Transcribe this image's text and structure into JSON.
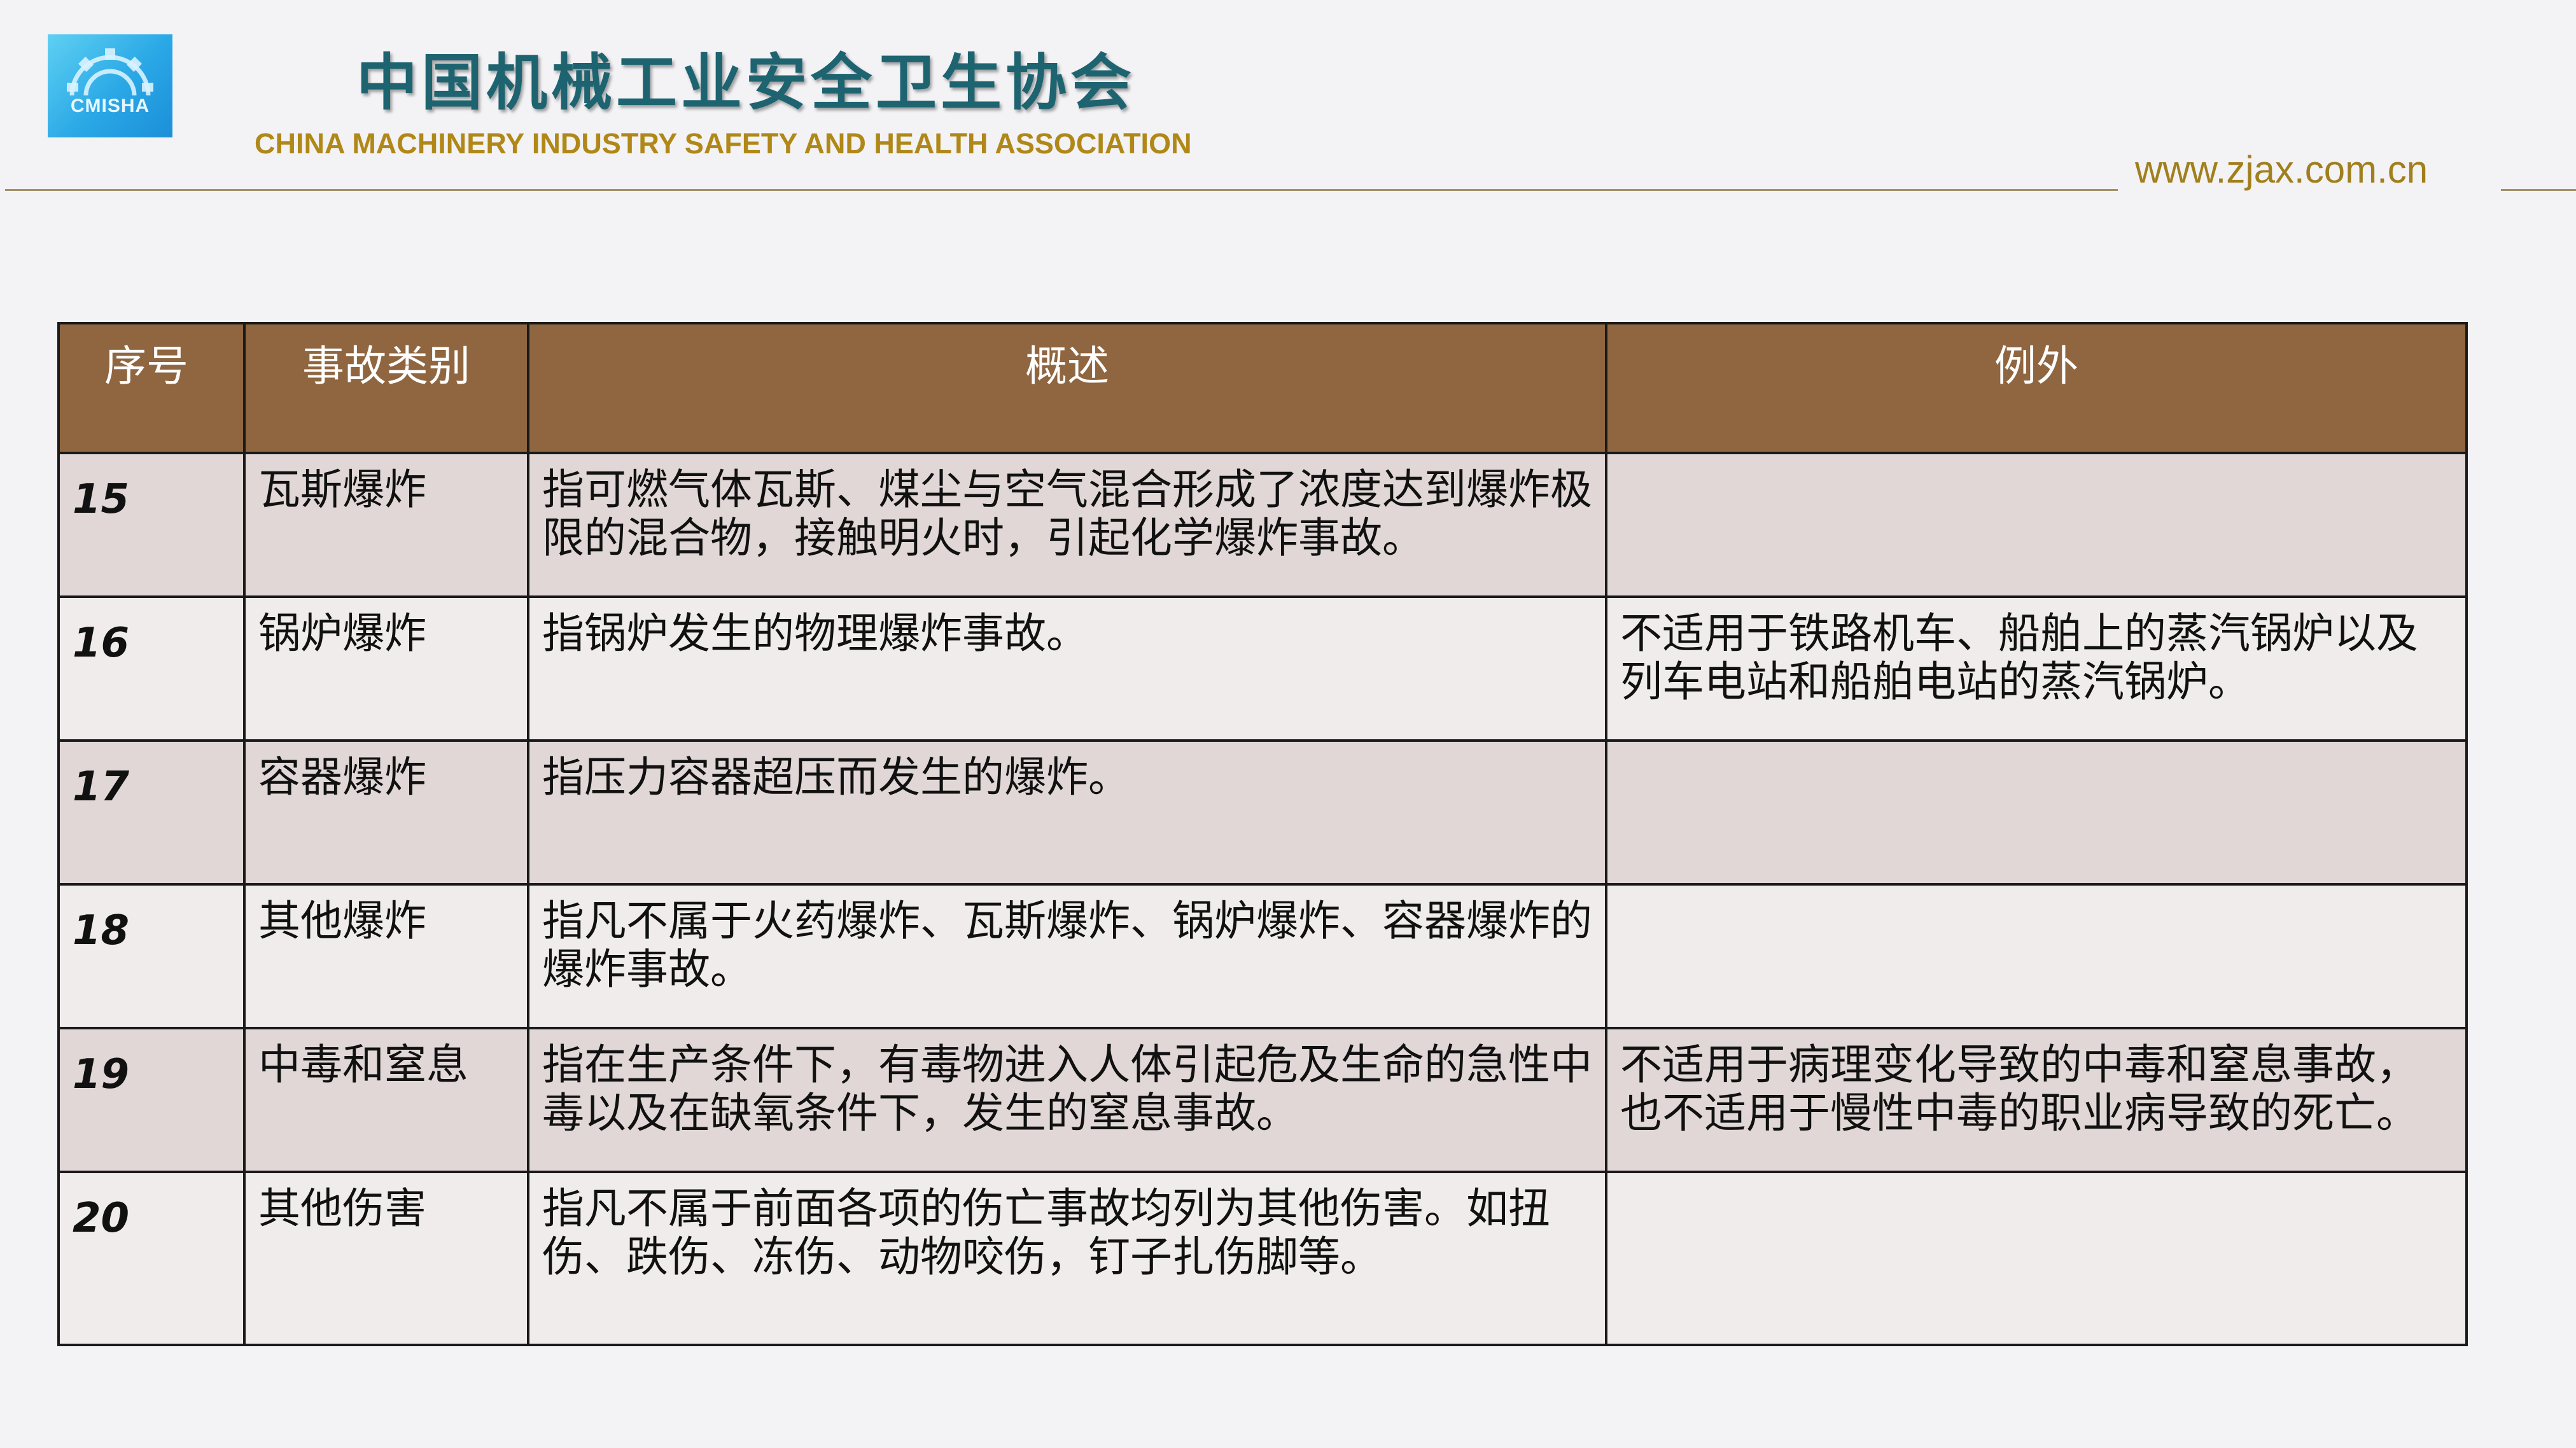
{
  "header": {
    "logo_text": "CMISHA",
    "title_cn": "中国机械工业安全卫生协会",
    "title_en": "CHINA MACHINERY INDUSTRY SAFETY AND HEALTH ASSOCIATION",
    "website": "www.zjax.com.cn"
  },
  "table": {
    "headers": [
      "序号",
      "事故类别",
      "概述",
      "例外"
    ],
    "rows": [
      {
        "no": "15",
        "category": "瓦斯爆炸",
        "summary": "指可燃气体瓦斯、煤尘与空气混合形成了浓度达到爆炸极限的混合物，接触明火时，引起化学爆炸事故。",
        "exception": ""
      },
      {
        "no": "16",
        "category": "锅炉爆炸",
        "summary": "指锅炉发生的物理爆炸事故。",
        "exception": "不适用于铁路机车、船舶上的蒸汽锅炉以及列车电站和船舶电站的蒸汽锅炉。"
      },
      {
        "no": "17",
        "category": "容器爆炸",
        "summary": "指压力容器超压而发生的爆炸。",
        "exception": ""
      },
      {
        "no": "18",
        "category": "其他爆炸",
        "summary": "指凡不属于火药爆炸、瓦斯爆炸、锅炉爆炸、容器爆炸的爆炸事故。",
        "exception": ""
      },
      {
        "no": "19",
        "category": "中毒和窒息",
        "summary": "指在生产条件下，有毒物进入人体引起危及生命的急性中毒以及在缺氧条件下，发生的窒息事故。",
        "exception": "不适用于病理变化导致的中毒和窒息事故，也不适用于慢性中毒的职业病导致的死亡。"
      },
      {
        "no": "20",
        "category": "其他伤害",
        "summary": "指凡不属于前面各项的伤亡事故均列为其他伤害。如扭伤、跌伤、冻伤、动物咬伤，钉子扎伤脚等。",
        "exception": ""
      }
    ]
  },
  "colors": {
    "header_bg": "#8f6640",
    "row_dark": "#e0d7d6",
    "row_light": "#efeceb",
    "title_cn": "#1d6470",
    "title_en": "#b08818"
  }
}
